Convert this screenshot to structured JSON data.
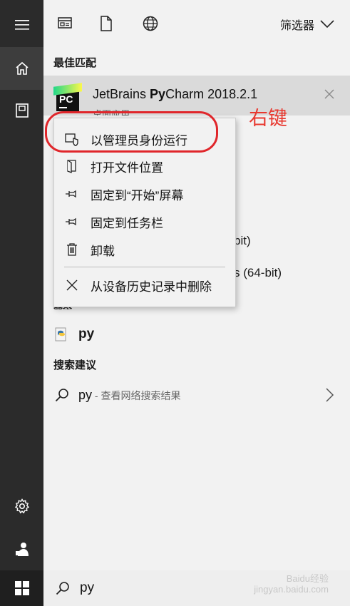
{
  "topbar": {
    "filter_label": "筛选器"
  },
  "sections": {
    "best_match": "最佳匹配",
    "search_suggestions": "搜索建议"
  },
  "best_match": {
    "app_name_prefix": "JetBrains ",
    "app_name_bold": "Py",
    "app_name_suffix": "Charm 2018.2.1",
    "subtitle": "桌面应用",
    "logo_text": "PC"
  },
  "annotation": {
    "label": "右键",
    "color": "#e8382f"
  },
  "context_menu": {
    "items": [
      {
        "label": "以管理员身份运行",
        "icon": "shield-icon"
      },
      {
        "label": "打开文件位置",
        "icon": "open-file-location-icon"
      },
      {
        "label": "固定到“开始”屏幕",
        "icon": "pin-icon"
      },
      {
        "label": "固定到任务栏",
        "icon": "pin-icon"
      },
      {
        "label": "卸载",
        "icon": "trash-icon"
      },
      {
        "label": "从设备历史记录中删除",
        "icon": "close-icon"
      }
    ]
  },
  "background_results": {
    "line1": "bit)",
    "line2": "s (64-bit)",
    "line3": "命令"
  },
  "app_result": {
    "name": "py"
  },
  "suggestion": {
    "query": "py",
    "hint": " - 查看网络搜索结果"
  },
  "taskbar": {
    "search_value": "py"
  },
  "watermark": {
    "line1": "Baidu经验",
    "line2": "jingyan.baidu.com"
  },
  "colors": {
    "rail": "#2b2b2b",
    "panel": "#f2f2f2",
    "highlight": "#dadada",
    "annotation_red": "#e0262b"
  }
}
